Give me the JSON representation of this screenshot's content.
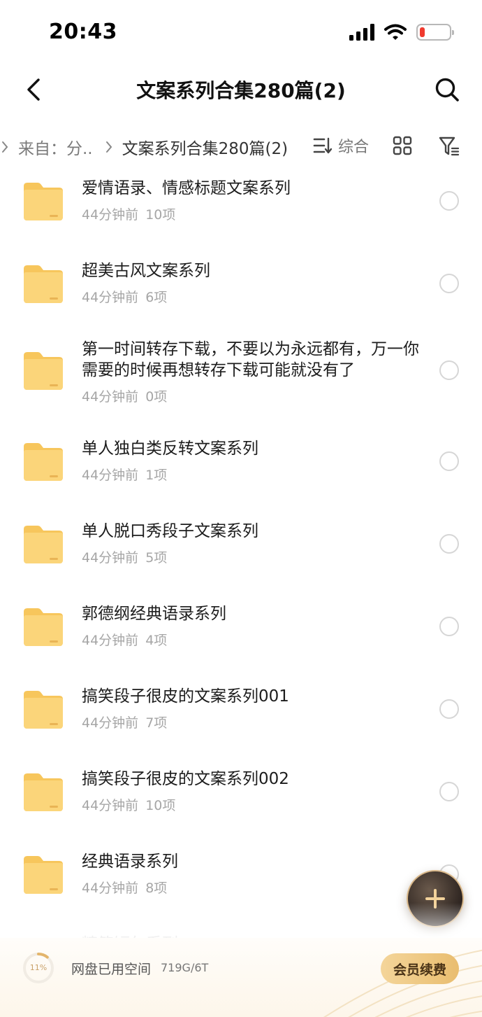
{
  "status_bar": {
    "time": "20:43",
    "battery_level": 0.15,
    "battery_color": "#f03a2e"
  },
  "nav": {
    "title": "文案系列合集280篇(2)",
    "back_icon": "chevron-left-icon",
    "search_icon": "search-icon"
  },
  "breadcrumb": {
    "from_label": "来自：分..",
    "current": "文案系列合集280篇(2)",
    "sort_label": "综合"
  },
  "files": [
    {
      "name": "爱情语录、情感标题文案系列",
      "time": "44分钟前",
      "count": "10项"
    },
    {
      "name": "超美古风文案系列",
      "time": "44分钟前",
      "count": "6项"
    },
    {
      "name": "第一时间转存下载，不要以为永远都有，万一你需要的时候再想转存下载可能就没有了",
      "time": "44分钟前",
      "count": "0项"
    },
    {
      "name": "单人独白类反转文案系列",
      "time": "44分钟前",
      "count": "1项"
    },
    {
      "name": "单人脱口秀段子文案系列",
      "time": "44分钟前",
      "count": "5项"
    },
    {
      "name": "郭德纲经典语录系列",
      "time": "44分钟前",
      "count": "4项"
    },
    {
      "name": "搞笑段子很皮的文案系列001",
      "time": "44分钟前",
      "count": "7项"
    },
    {
      "name": "搞笑段子很皮的文案系列002",
      "time": "44分钟前",
      "count": "10项"
    },
    {
      "name": "经典语录系列",
      "time": "44分钟前",
      "count": "8项"
    },
    {
      "name": "精简短句系列",
      "time": "",
      "count": ""
    }
  ],
  "storage": {
    "percent": "11%",
    "percent_value": 0.11,
    "label": "网盘已用空间",
    "value": "719G/6T",
    "renew_label": "会员续费"
  },
  "colors": {
    "folder": "#fbd57a",
    "accent_gold": "#e9bd6f",
    "fab_dark": "#2d2420"
  }
}
